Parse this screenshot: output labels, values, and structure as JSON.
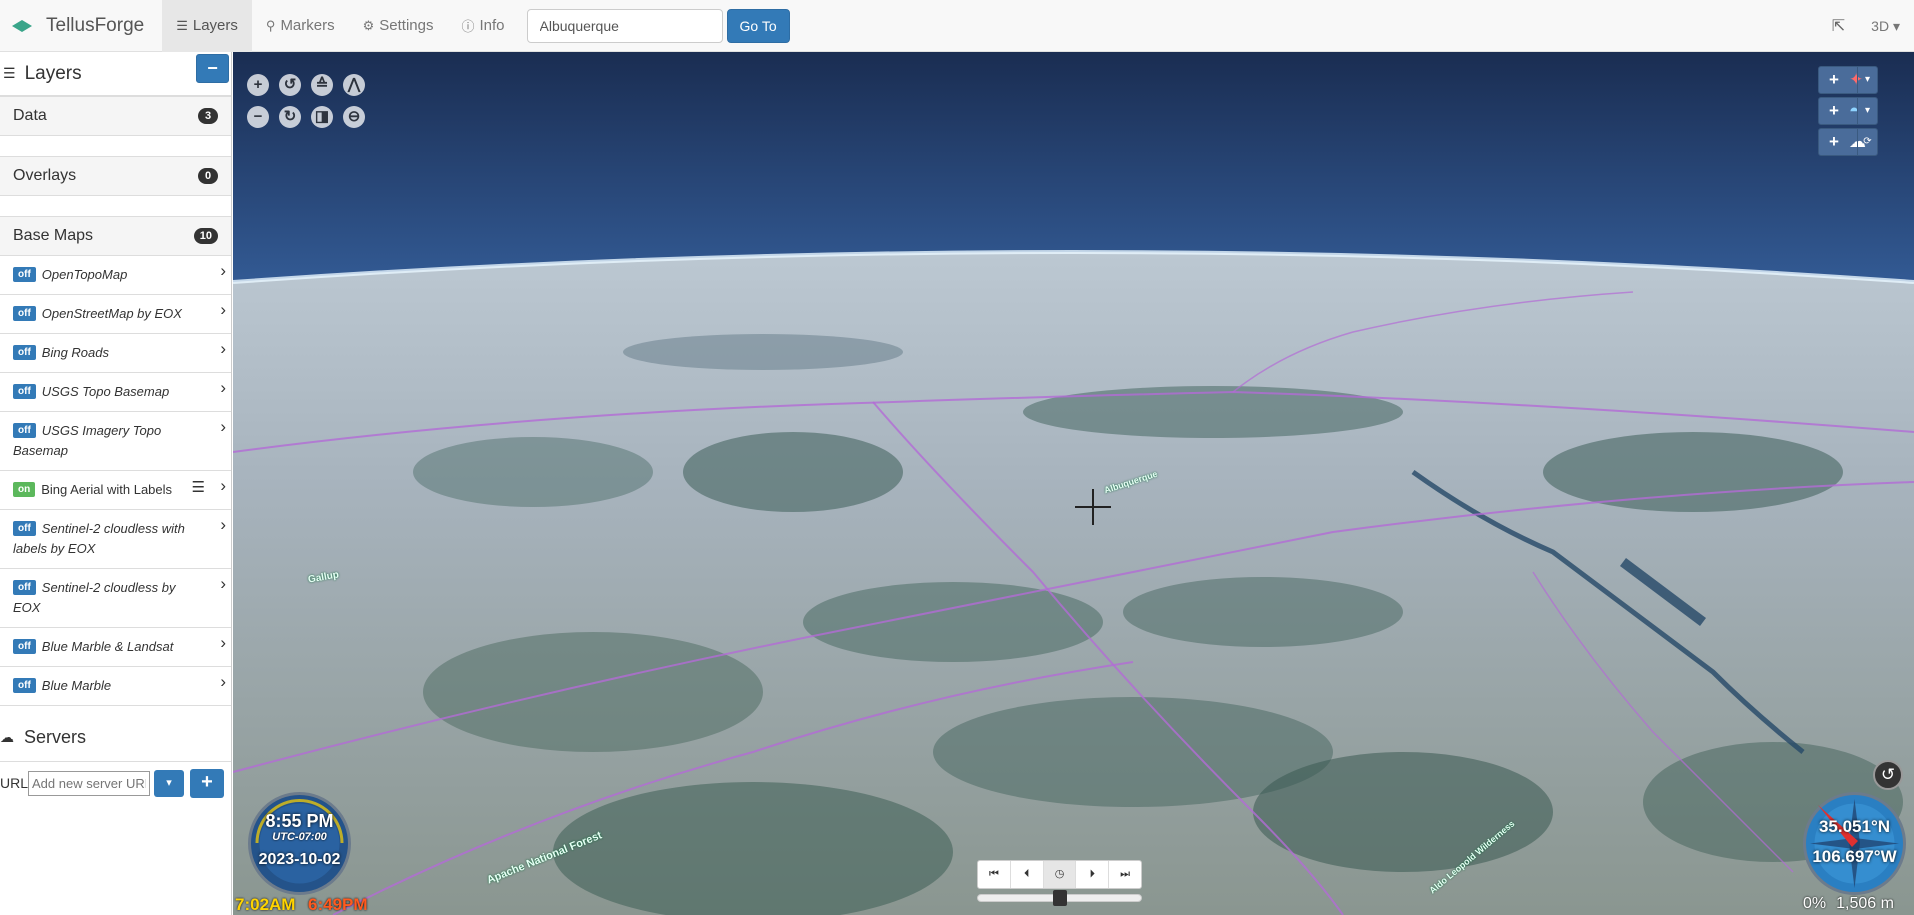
{
  "app": {
    "title": "TellusForge"
  },
  "nav": {
    "layers": "Layers",
    "markers": "Markers",
    "settings": "Settings",
    "info": "Info"
  },
  "search": {
    "value": "Albuquerque",
    "goto_label": "Go To"
  },
  "view_mode": "3D",
  "sidebar": {
    "title": "Layers",
    "collapse_label": "−",
    "panels": [
      {
        "label": "Data",
        "count": "3"
      },
      {
        "label": "Overlays",
        "count": "0"
      },
      {
        "label": "Base Maps",
        "count": "10"
      }
    ],
    "base_maps": [
      {
        "state": "off",
        "name": "OpenTopoMap"
      },
      {
        "state": "off",
        "name": "OpenStreetMap by EOX"
      },
      {
        "state": "off",
        "name": "Bing Roads"
      },
      {
        "state": "off",
        "name": "USGS Topo Basemap"
      },
      {
        "state": "off",
        "name": "USGS Imagery Topo Basemap"
      },
      {
        "state": "on",
        "name": "Bing Aerial with Labels"
      },
      {
        "state": "off",
        "name": "Sentinel-2 cloudless with labels by EOX"
      },
      {
        "state": "off",
        "name": "Sentinel-2 cloudless by EOX"
      },
      {
        "state": "off",
        "name": "Blue Marble & Landsat"
      },
      {
        "state": "off",
        "name": "Blue Marble"
      }
    ],
    "servers": {
      "title": "Servers",
      "url_label": "URL",
      "url_placeholder": "Add new server URL"
    }
  },
  "map": {
    "clock": {
      "time": "8:55 PM",
      "timezone": "UTC-07:00",
      "date": "2023-10-02",
      "sunrise": "7:02AM",
      "sunset": "6:49PM"
    },
    "position": {
      "lat": "35.051°N",
      "lon": "106.697°W"
    },
    "status": {
      "progress": "0%",
      "elevation": "1,506 m"
    },
    "labels": [
      {
        "text": "Albuquerque"
      },
      {
        "text": "Apache National Forest"
      },
      {
        "text": "Aldo Leopold Wilderness"
      },
      {
        "text": "Gallup"
      }
    ],
    "colors": {
      "space": "#1a2d52",
      "horizon": "#a8d2f0",
      "terrain": "#9aa8b4",
      "forest": "#3e5f5a",
      "roads": "#b36bd6",
      "accent": "#337ab7"
    }
  }
}
